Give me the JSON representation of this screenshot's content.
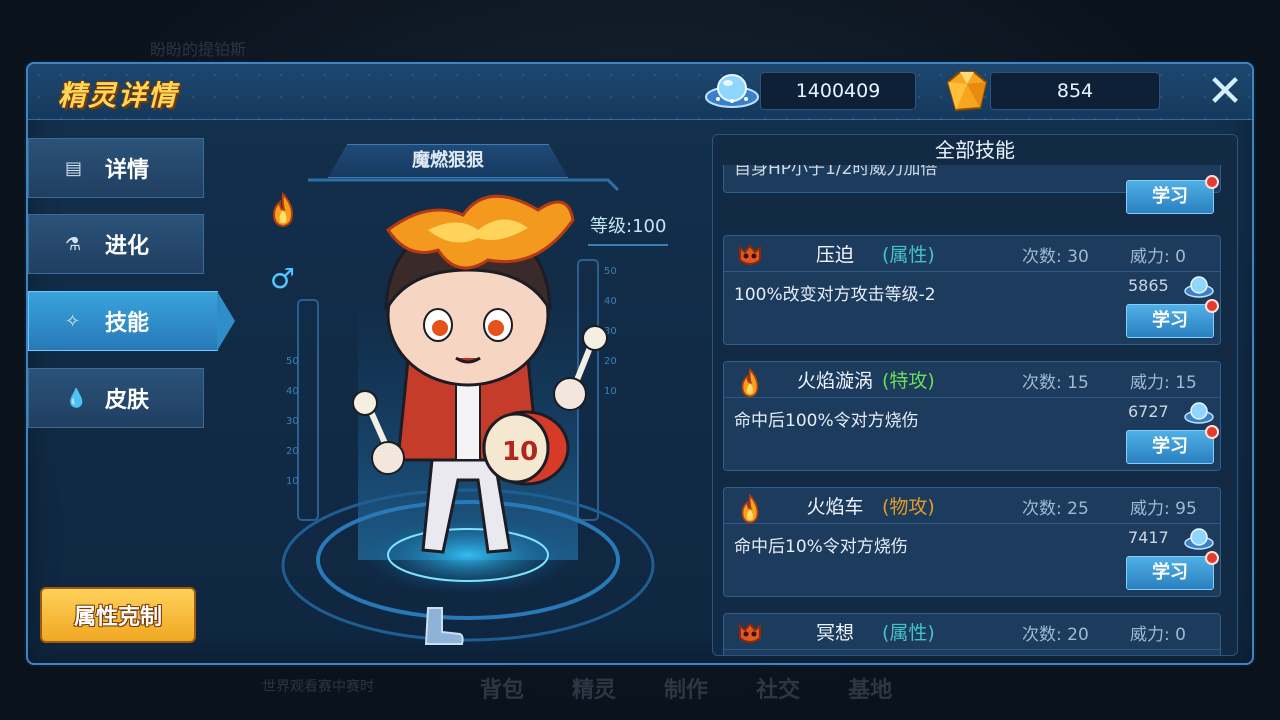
{
  "background": {
    "top_text": "盼盼的提铂斯",
    "bottom_left_text": "世界观看赛中赛时",
    "bottom_nav": [
      "背包",
      "精灵",
      "制作",
      "社交",
      "基地"
    ]
  },
  "header": {
    "title": "精灵详情",
    "currency1": "1400409",
    "currency2": "854",
    "close_label": "✕"
  },
  "sidebar": {
    "items": [
      {
        "label": "详情",
        "icon": "book-icon"
      },
      {
        "label": "进化",
        "icon": "flask-icon"
      },
      {
        "label": "技能",
        "icon": "wand-icon",
        "active": true
      },
      {
        "label": "皮肤",
        "icon": "drop-icon"
      }
    ],
    "attr_button": "属性克制"
  },
  "character": {
    "name": "魔燃狠狠",
    "level": "等级:100",
    "gender": "♂",
    "element": "fire"
  },
  "skills": {
    "title": "全部技能",
    "learn_label": "学习",
    "partial_desc": "自身HP小于1/2时威力加倍",
    "list": [
      {
        "name": "压迫",
        "type": "(属性)",
        "count": "次数: 30",
        "power": "威力: 0",
        "desc": "100%改变对方攻击等级-2",
        "cost": "5865"
      },
      {
        "name": "火焰漩涡",
        "type": "(特攻)",
        "count": "次数: 15",
        "power": "威力: 15",
        "desc": "命中后100%令对方烧伤",
        "cost": "6727"
      },
      {
        "name": "火焰车",
        "type": "(物攻)",
        "count": "次数: 25",
        "power": "威力: 95",
        "desc": "命中后10%令对方烧伤",
        "cost": "7417"
      },
      {
        "name": "冥想",
        "type": "(属性)",
        "count": "次数: 20",
        "power": "威力: 0"
      }
    ]
  },
  "colors": {
    "accent": "#3aa3dc",
    "gold": "#ffd65a",
    "attr_type": "#43c3c6",
    "special_type": "#6cdc5a",
    "physical_type": "#e19a2c"
  }
}
